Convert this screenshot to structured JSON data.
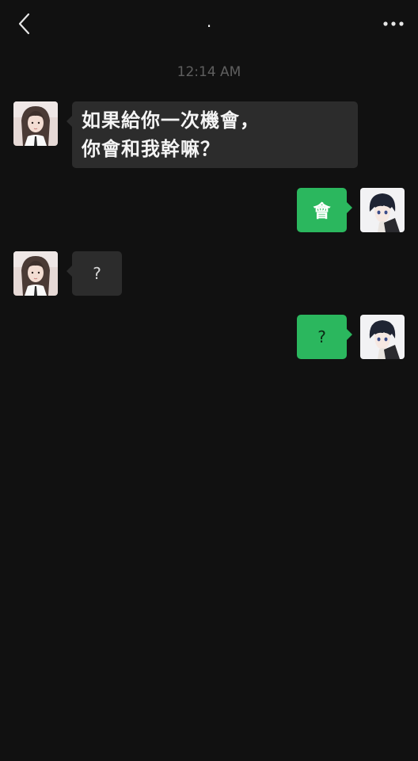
{
  "header": {
    "title": ".",
    "back_icon": "chevron-left-icon",
    "more_icon": "more-dots-icon"
  },
  "timestamp": "12:14 AM",
  "messages": [
    {
      "side": "left",
      "lines": [
        "如果給你一次機會，",
        "你會和我幹嘛？"
      ]
    },
    {
      "side": "right",
      "text": "會"
    },
    {
      "side": "left",
      "text": "?"
    },
    {
      "side": "right",
      "text": "?"
    }
  ],
  "colors": {
    "background": "#111111",
    "incoming_bubble": "#2c2c2c",
    "outgoing_bubble": "#2bb75e",
    "timestamp": "#5f5f5f"
  }
}
